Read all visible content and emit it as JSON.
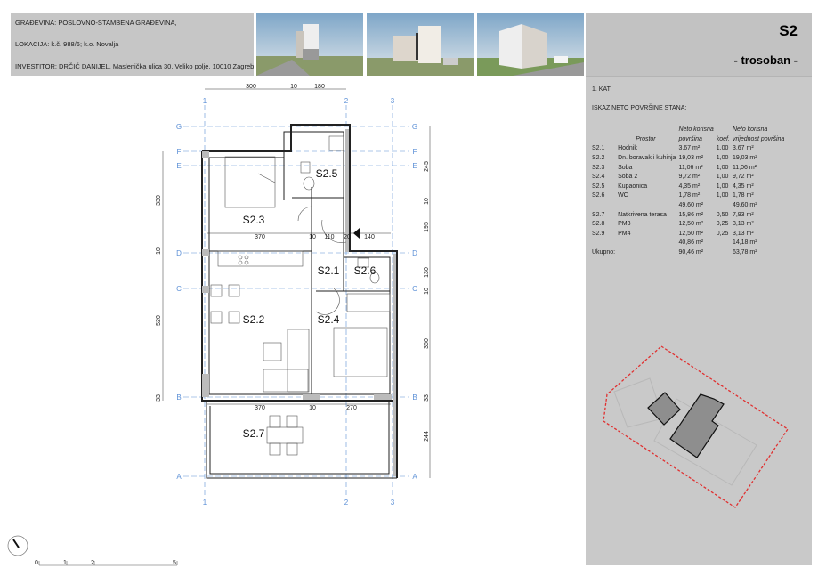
{
  "header": {
    "gradevina": "GRAĐEVINA:  POSLOVNO-STAMBENA GRAĐEVINA,",
    "lokacija": "LOKACIJA:    k.č. 988/6; k.o. Novalja",
    "investitor": "INVESTITOR: DRČIĆ DANIJEL,  Masleničkа ulica 30, Veliko polje, 10010 Zagreb",
    "unit": "S2",
    "type": "- trosoban -"
  },
  "panel": {
    "floor": "1. KAT",
    "title": "ISKAZ NETO POVRŠINE STANA:",
    "col_headers": {
      "prostor": "Prostor",
      "neto1": "Neto korisna",
      "neto2": "površina",
      "koef": "koef.",
      "vr1": "Neto korisna",
      "vr2": "vrijednost površina"
    },
    "rows": [
      {
        "id": "S2.1",
        "name": "Hodnik",
        "area": "3,67 m²",
        "koef": "1,00",
        "value": "3,67 m²"
      },
      {
        "id": "S2.2",
        "name": "Dn. boravak i kuhinja",
        "area": "19,03 m²",
        "koef": "1,00",
        "value": "19,03 m²"
      },
      {
        "id": "S2.3",
        "name": "Soba",
        "area": "11,06 m²",
        "koef": "1,00",
        "value": "11,06 m²"
      },
      {
        "id": "S2.4",
        "name": "Soba 2",
        "area": "9,72 m²",
        "koef": "1,00",
        "value": "9,72 m²"
      },
      {
        "id": "S2.5",
        "name": "Kupaonica",
        "area": "4,35 m²",
        "koef": "1,00",
        "value": "4,35 m²"
      },
      {
        "id": "S2.6",
        "name": "WC",
        "area": "1,78 m²",
        "koef": "1,00",
        "value": "1,78 m²"
      },
      {
        "id": "",
        "name": "",
        "area": "49,60 m²",
        "koef": "",
        "value": "49,60 m²"
      },
      {
        "id": "S2.7",
        "name": "Natkrivena terasa",
        "area": "15,86 m²",
        "koef": "0,50",
        "value": "7,93 m²"
      },
      {
        "id": "S2.8",
        "name": "PM3",
        "area": "12,50 m²",
        "koef": "0,25",
        "value": "3,13 m²"
      },
      {
        "id": "S2.9",
        "name": "PM4",
        "area": "12,50 m²",
        "koef": "0,25",
        "value": "3,13 m²"
      },
      {
        "id": "",
        "name": "",
        "area": "40,86 m²",
        "koef": "",
        "value": "14,18 m²"
      },
      {
        "id": "Ukupno:",
        "name": "",
        "area": "90,46 m²",
        "koef": "",
        "value": "63,78 m²"
      }
    ]
  },
  "plan": {
    "axes_cols": [
      "1",
      "2",
      "3"
    ],
    "axes_rows": [
      "G",
      "F",
      "E",
      "D",
      "C",
      "B",
      "A"
    ],
    "rooms": [
      "S2.5",
      "S2.3",
      "S2.1",
      "S2.6",
      "S2.2",
      "S2.4",
      "S2.7"
    ],
    "dims_top": [
      "300",
      "10",
      "180"
    ],
    "dims_mid": [
      "370",
      "10",
      "110",
      "20",
      "140"
    ],
    "dims_low": [
      "370",
      "10",
      "270"
    ],
    "dims_left": [
      "330",
      "10",
      "520",
      "33"
    ],
    "dims_right": [
      "245",
      "10",
      "195",
      "130",
      "10",
      "360",
      "33",
      "244"
    ]
  },
  "scale": {
    "labels": [
      "0",
      "1",
      "2",
      "5"
    ]
  },
  "colors": {
    "grid": "#5b8fd6",
    "boundary": "#e03030",
    "panel": "#c9c9c9"
  }
}
